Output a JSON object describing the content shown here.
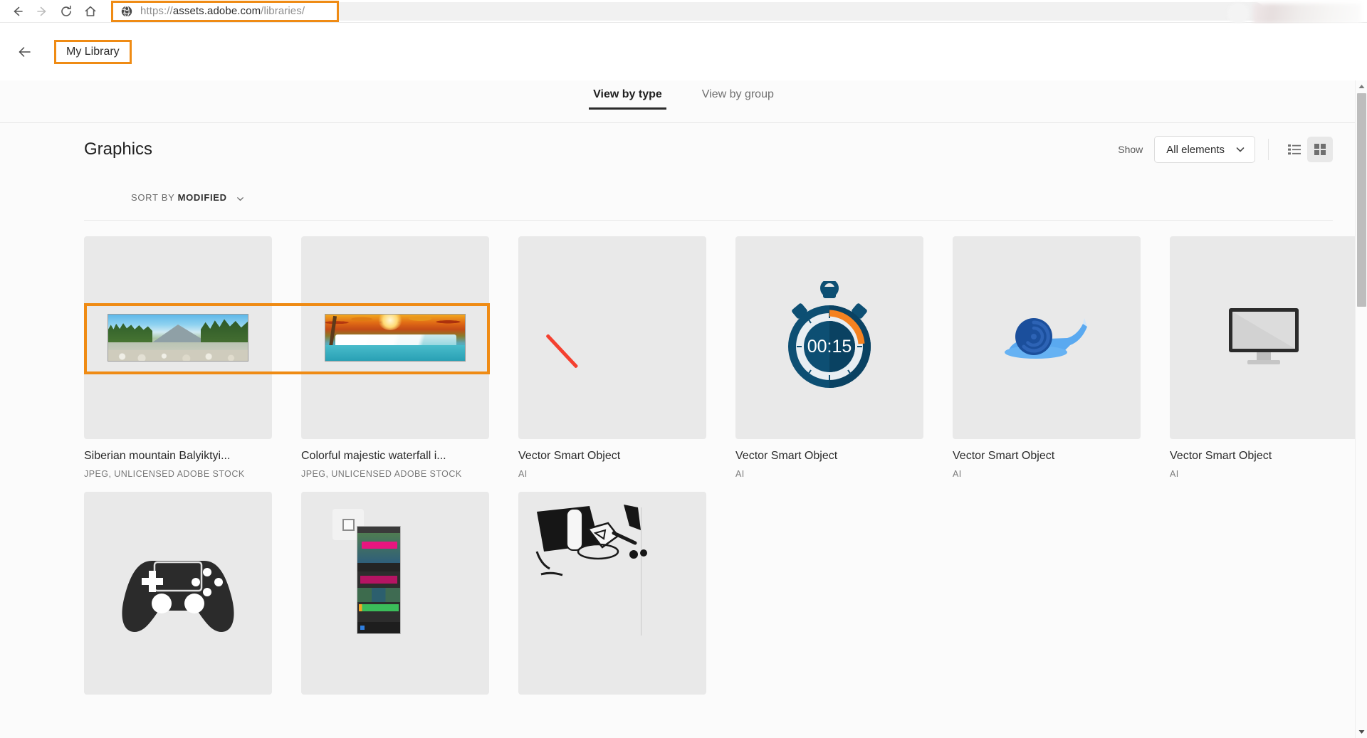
{
  "browser": {
    "back_label": "Back",
    "forward_label": "Forward",
    "reload_label": "Reload",
    "home_label": "Home",
    "url_scheme": "https://",
    "url_domain": "assets.adobe.com",
    "url_path": "/libraries/",
    "url_full": "https://assets.adobe.com/libraries/",
    "highlight_color": "#ef8b14"
  },
  "page_header": {
    "back_label": "Back",
    "library_button": "My Library"
  },
  "tabs": [
    {
      "label": "View by type",
      "active": true
    },
    {
      "label": "View by group",
      "active": false
    }
  ],
  "section": {
    "title": "Graphics",
    "show_label": "Show",
    "show_value": "All elements",
    "list_view_label": "List view",
    "grid_view_label": "Grid view",
    "sort_prefix": "SORT BY",
    "sort_value": "MODIFIED"
  },
  "assets": [
    {
      "title": "Siberian mountain Balyiktyi...",
      "meta": "JPEG, UNLICENSED ADOBE STOCK",
      "kind": "photo-mountain",
      "selected": true
    },
    {
      "title": "Colorful majestic waterfall i...",
      "meta": "JPEG, UNLICENSED ADOBE STOCK",
      "kind": "photo-waterfall",
      "selected": true
    },
    {
      "title": "Vector Smart Object",
      "meta": "AI",
      "kind": "red-stroke",
      "selected": false
    },
    {
      "title": "Vector Smart Object",
      "meta": "AI",
      "kind": "stopwatch",
      "timer_value": "00:15",
      "selected": false
    },
    {
      "title": "Vector Smart Object",
      "meta": "AI",
      "kind": "snail",
      "selected": false
    },
    {
      "title": "Vector Smart Object",
      "meta": "AI",
      "kind": "monitor",
      "selected": false
    },
    {
      "title": "",
      "meta": "",
      "kind": "gamepad",
      "selected": false
    },
    {
      "title": "",
      "meta": "",
      "kind": "phone-app",
      "selected": false
    },
    {
      "title": "",
      "meta": "",
      "kind": "sketch",
      "selected": false
    }
  ],
  "scrollbar": {
    "up_label": "Scroll up",
    "down_label": "Scroll down",
    "thumb_label": "Scroll thumb"
  }
}
